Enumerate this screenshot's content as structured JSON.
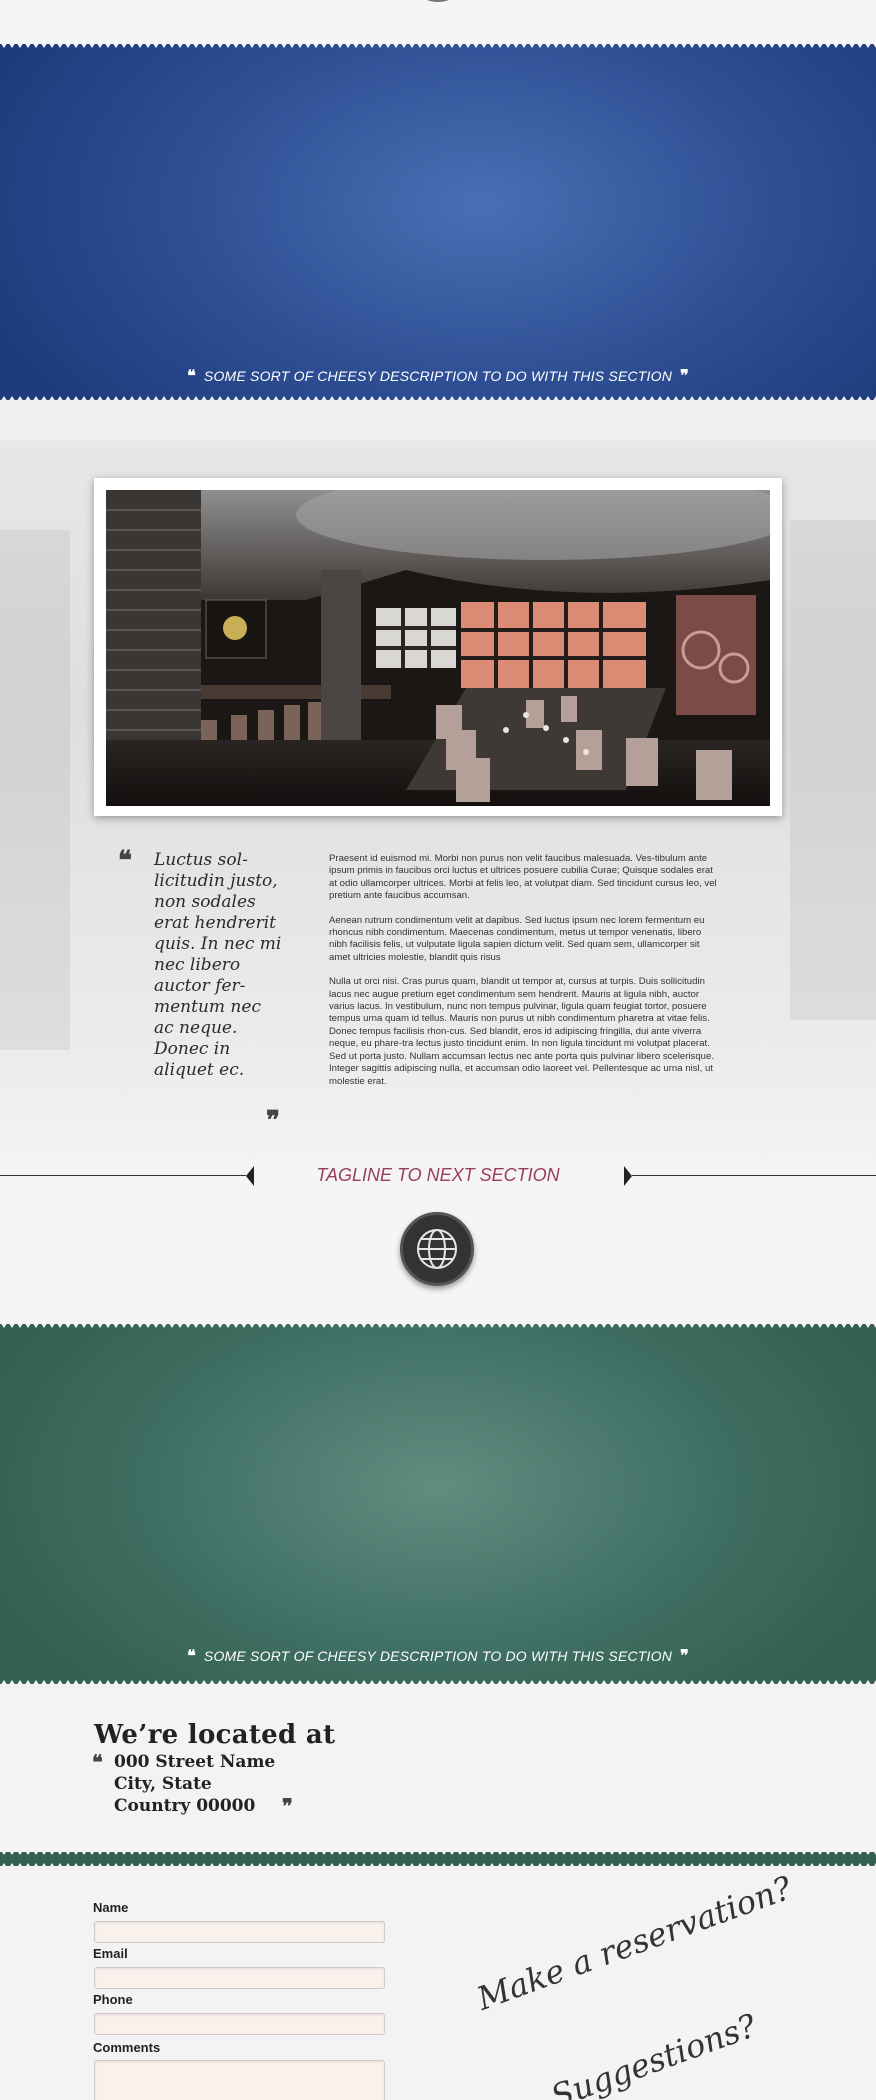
{
  "sections": {
    "blue_band": {
      "caption": "SOME SORT OF CHEESY DESCRIPTION TO DO WITH THIS SECTION",
      "open_quote": "❝",
      "close_quote": "❞",
      "color": "#2f4f95"
    },
    "restaurant": {
      "pull_quote": "Luctus sol-licitudin justo, non sodales erat hendrerit quis. In nec mi nec libero auctor fer-mentum nec ac neque. Donec in aliquet ec.",
      "open_quote": "❝",
      "close_quote": "❞",
      "paragraphs": [
        "Praesent id euismod mi. Morbi non purus non velit faucibus malesuada. Ves-tibulum ante ipsum primis in faucibus orci luctus et ultrices posuere cubilia Curae; Quisque sodales erat at odio ullamcorper ultrices. Morbi at felis leo, at volutpat diam. Sed tincidunt cursus leo, vel pretium ante faucibus accumsan.",
        "Aenean rutrum condimentum velit at dapibus. Sed luctus ipsum nec lorem fermentum eu rhoncus nibh condimentum. Maecenas condimentum, metus ut tempor venenatis, libero nibh facilisis felis, ut vulputate ligula sapien dictum velit. Sed quam sem, ullamcorper sit amet ultricies molestie, blandit quis risus",
        "Nulla ut orci nisi. Cras purus quam, blandit ut tempor at, cursus at turpis. Duis sollicitudin lacus nec augue pretium eget condimentum sem hendrerit. Mauris at ligula nibh, auctor varius lacus. In vestibulum, nunc non tempus pulvinar, ligula quam feugiat tortor, posuere tempus urna quam id tellus. Mauris non purus ut nibh condimentum pharetra at vitae felis. Donec tempus facilisis rhon-cus. Sed blandit, eros id adipiscing fringilla, dui ante viverra neque, eu phare-tra lectus justo tincidunt enim. In non ligula tincidunt mi volutpat placerat. Sed ut porta justo. Nullam accumsan lectus nec ante porta quis pulvinar libero scelerisque. Integer sagittis adipiscing nulla, et accumsan odio laoreet vel. Pellentesque ac urna nisl, ut molestie erat."
      ]
    },
    "tagline": {
      "text": "TAGLINE TO NEXT SECTION",
      "color": "#9a3d5a"
    },
    "green_band": {
      "caption": "SOME SORT OF CHEESY DESCRIPTION TO DO WITH THIS SECTION",
      "open_quote": "❝",
      "close_quote": "❞",
      "color": "#3f6e62"
    },
    "location": {
      "title": "We’re located at",
      "open_quote": "❝",
      "close_quote": "❞",
      "street": "000 Street Name",
      "city": "City, State",
      "country": "Country 00000"
    },
    "form": {
      "name_label": "Name",
      "email_label": "Email",
      "phone_label": "Phone",
      "comments_label": "Comments",
      "reservation_text": "Make a reservation?",
      "suggestions_text": "Suggestions?"
    }
  },
  "icons": {
    "globe": "globe-icon",
    "quote": "quote-icon",
    "arrow_left": "arrow-left-icon",
    "arrow_right": "arrow-right-icon"
  }
}
